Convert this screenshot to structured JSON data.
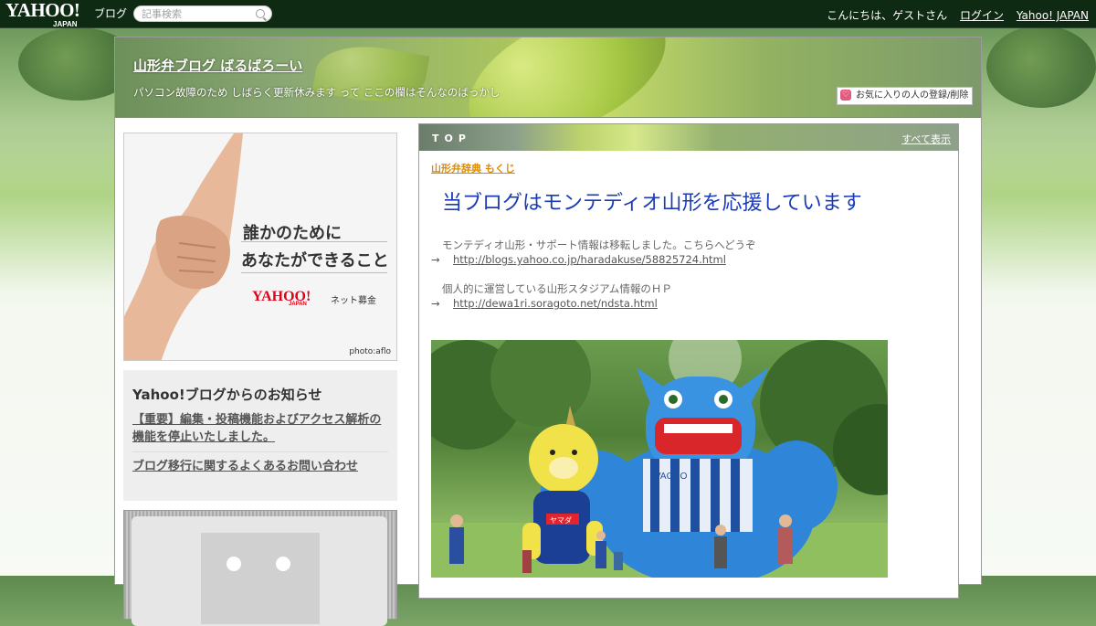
{
  "topbar": {
    "logo_text": "YAHOO!",
    "logo_japan": "JAPAN",
    "logo_sub": "ブログ",
    "search_placeholder": "記事検索",
    "greeting": "こんにちは、ゲストさん",
    "login": "ログイン",
    "yahoo_japan": "Yahoo! JAPAN"
  },
  "header": {
    "blog_title": "山形弁ブログ ばるばろーい",
    "description": "パソコン故障のため しばらく更新休みます って ここの欄はそんなのばっかし",
    "favorite_button": "お気に入りの人の登録/削除"
  },
  "ad": {
    "line1": "誰かのために",
    "line2": "あなたができること",
    "logo": "YAHOO!",
    "logo_japan": "JAPAN",
    "sub": "ネット募金",
    "credit": "photo:aflo"
  },
  "notice": {
    "title": "Yahoo!ブログからのお知らせ",
    "items": [
      "【重要】編集・投稿機能およびアクセス解析の機能を停止いたしました。",
      "ブログ移行に関するよくあるお問い合わせ"
    ]
  },
  "article": {
    "label": "TOP",
    "show_all": "すべて表示",
    "category": "山形弁辞典 もくじ",
    "title": "当ブログはモンテディオ山形を応援しています",
    "text1": "モンテディオ山形・サポート情報は移転しました。こちらへどうぞ",
    "arrow": "→",
    "link1": "http://blogs.yahoo.co.jp/haradakuse/58825724.html",
    "text2": "個人的に運営している山形スタジアム情報のＨＰ",
    "link2": "http://dewa1ri.soragoto.net/ndsta.html",
    "photo_banner": "ヤマダ",
    "photo_sign": "VAGRO"
  },
  "colors": {
    "topbar_bg": "#0f2a12",
    "title_link": "#1a3bb5",
    "category": "#e08a00"
  }
}
